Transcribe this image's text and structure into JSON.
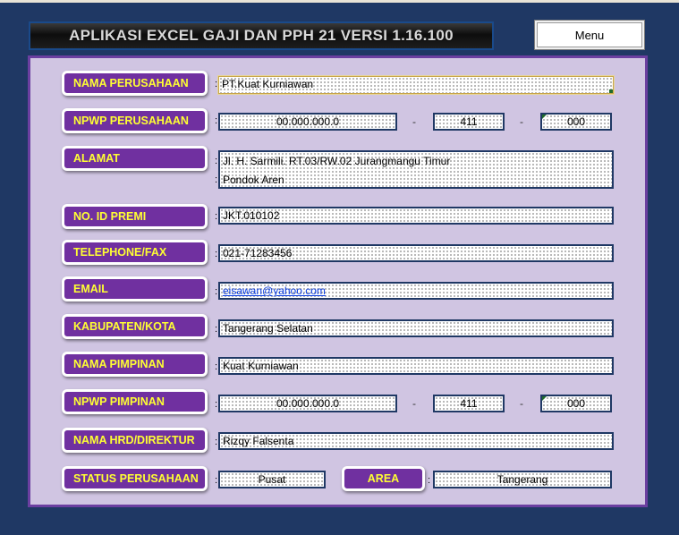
{
  "app": {
    "title": "APLIKASI EXCEL GAJI DAN PPH 21 VERSI 1.16.100",
    "menu_label": "Menu"
  },
  "form": {
    "company_name": {
      "label": "NAMA PERUSAHAAN",
      "value": "PT.Kuat Kurniawan"
    },
    "company_npwp": {
      "label": "NPWP PERUSAHAAN",
      "part1": "00.000.000.0",
      "part2": "411",
      "part3": "000"
    },
    "address": {
      "label": "ALAMAT",
      "line1": "Jl. H. Sarmili. RT.03/RW.02 Jurangmangu Timur",
      "line2": "Pondok Aren"
    },
    "premium_id": {
      "label": "NO. ID PREMI",
      "value": "JKT.010102"
    },
    "phone": {
      "label": "TELEPHONE/FAX",
      "value": "021-71283456"
    },
    "email": {
      "label": "EMAIL",
      "value": "eisawan@yahoo.com"
    },
    "city": {
      "label": "KABUPATEN/KOTA",
      "value": "Tangerang Selatan"
    },
    "leader_name": {
      "label": "NAMA PIMPINAN",
      "value": "Kuat Kurniawan"
    },
    "leader_npwp": {
      "label": "NPWP PIMPINAN",
      "part1": "00.000.000.0",
      "part2": "411",
      "part3": "000"
    },
    "hrd_name": {
      "label": "NAMA HRD/DIREKTUR",
      "value": "Rizqy Falsenta"
    },
    "status": {
      "label": "STATUS PERUSAHAAN",
      "value": "Pusat"
    },
    "area": {
      "label": "AREA",
      "value": "Tangerang"
    },
    "colon": ":",
    "dash": "-"
  },
  "colors": {
    "background": "#1f3864",
    "panel": "#d0c5e2",
    "panel_border": "#6b3fa0",
    "label_bg": "#7030a0",
    "label_text": "#ffff33"
  }
}
